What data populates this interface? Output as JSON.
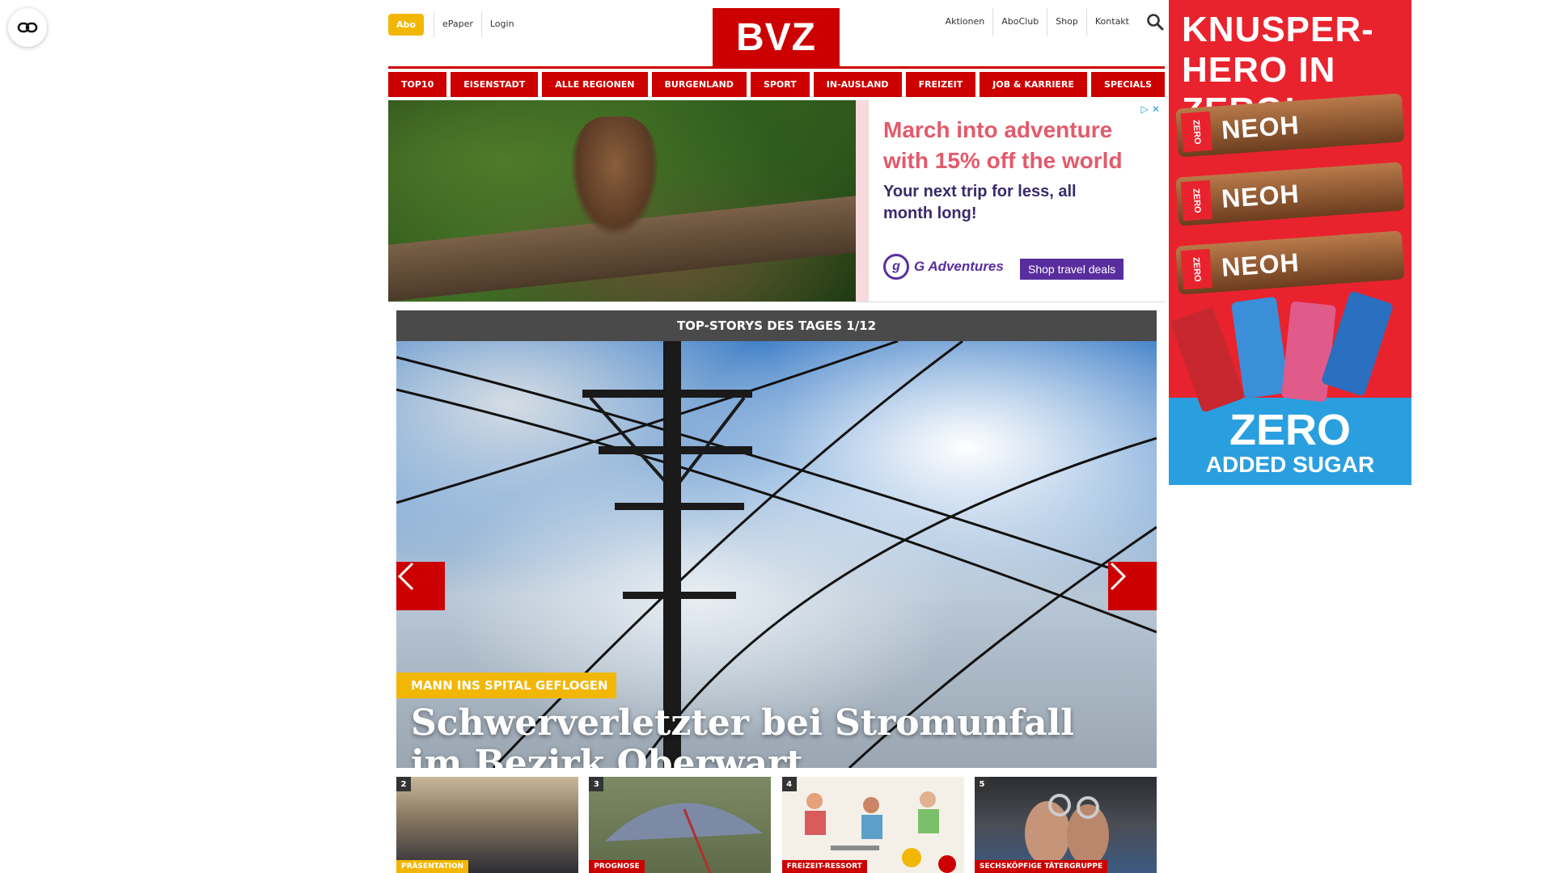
{
  "header": {
    "abo": "Abo",
    "left_links": [
      "ePaper",
      "Login"
    ],
    "logo": "BVZ",
    "right_links": [
      "Aktionen",
      "AboClub",
      "Shop",
      "Kontakt"
    ],
    "search_icon": "search-icon"
  },
  "nav": [
    "TOP10",
    "EISENSTADT",
    "ALLE REGIONEN",
    "BURGENLAND",
    "SPORT",
    "IN-AUSLAND",
    "FREIZEIT",
    "JOB & KARRIERE",
    "SPECIALS"
  ],
  "ad_banner": {
    "headline": "March into adventure with 15% off the world",
    "subline": "Your next trip for less, all month long!",
    "brand": "G Adventures",
    "cta": "Shop travel deals",
    "adchoices": "▷ ✕"
  },
  "hero": {
    "bar_title": "TOP-STORYS DES TAGES 1/12",
    "tag": "MANN INS SPITAL GEFLOGEN",
    "title": "Schwerverletzter bei Stromunfall im Bezirk Oberwart"
  },
  "teasers": [
    {
      "num": "2",
      "tag": "PRÄSENTATION"
    },
    {
      "num": "3",
      "tag": "PROGNOSE"
    },
    {
      "num": "4",
      "tag": "FREIZEIT-RESSORT"
    },
    {
      "num": "5",
      "tag": "SECHSKÖPFIGE TÄTERGRUPPE"
    }
  ],
  "sky_ad": {
    "headline": "KNUSPER-HERO IN ZERO!",
    "bar_brand": "NEOH",
    "zero": "ZERO",
    "sugar": "ADDED SUGAR"
  },
  "colors": {
    "brand_red": "#cc0000",
    "accent_yellow": "#f2b705",
    "hero_bar": "#4a4a4a"
  }
}
